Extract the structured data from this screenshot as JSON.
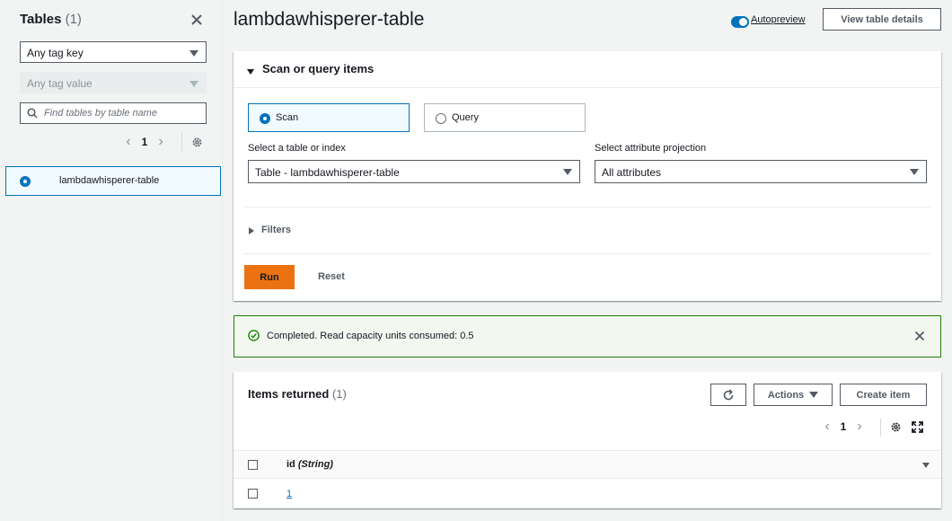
{
  "sidebar": {
    "title": "Tables",
    "count": "(1)",
    "tag_key_placeholder": "Any tag key",
    "tag_value_placeholder": "Any tag value",
    "search_placeholder": "Find tables by table name",
    "page": "1",
    "items": [
      {
        "label": "lambdawhisperer-table",
        "selected": true
      }
    ]
  },
  "header": {
    "title": "lambdawhisperer-table",
    "autopreview_label": "Autopreview",
    "autopreview_on": true,
    "view_details_label": "View table details"
  },
  "scan_panel": {
    "title": "Scan or query items",
    "modes": [
      {
        "label": "Scan",
        "selected": true
      },
      {
        "label": "Query",
        "selected": false
      }
    ],
    "table_index_label": "Select a table or index",
    "table_index_value": "Table - lambdawhisperer-table",
    "projection_label": "Select attribute projection",
    "projection_value": "All attributes",
    "filters_label": "Filters",
    "run_label": "Run",
    "reset_label": "Reset"
  },
  "flash": {
    "message": "Completed. Read capacity units consumed: 0.5",
    "type": "success"
  },
  "items_panel": {
    "title": "Items returned",
    "count": "(1)",
    "actions_label": "Actions",
    "create_label": "Create item",
    "page": "1",
    "column_name": "id",
    "column_type": "(String)",
    "rows": [
      {
        "id": "1"
      }
    ]
  },
  "colors": {
    "accent": "#0073bb",
    "run_button": "#ec7211",
    "success": "#1d8102"
  }
}
